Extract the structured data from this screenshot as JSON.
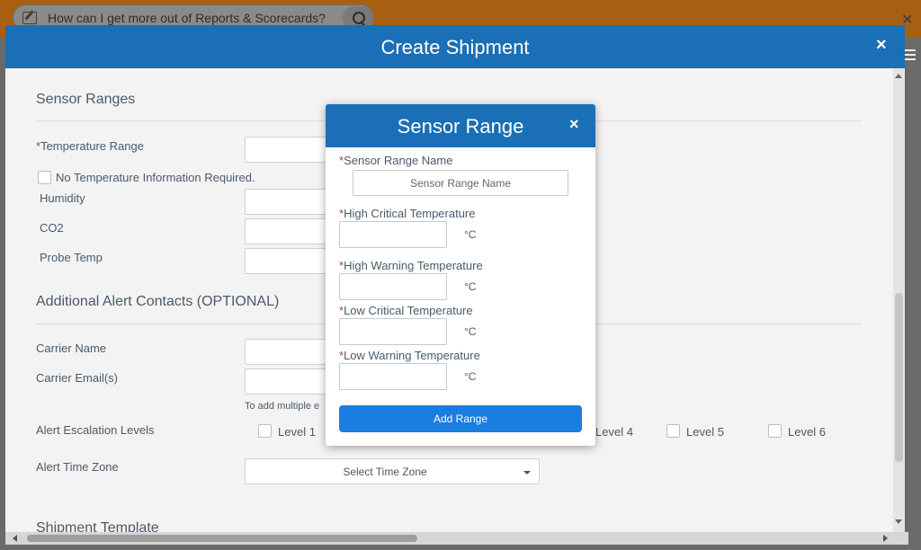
{
  "helpbar": {
    "question": "How can I get more out of Reports & Scorecards?"
  },
  "modal": {
    "title": "Create Shipment",
    "close": "×",
    "sensor_section": {
      "title": "Sensor Ranges",
      "temperature_label": "Temperature Range",
      "no_temp_label": "No Temperature Information Required.",
      "humidity_label": "Humidity",
      "co2_label": "CO2",
      "probe_label": "Probe Temp"
    },
    "alert_section": {
      "title": "Additional Alert Contacts (OPTIONAL)",
      "carrier_name_label": "Carrier Name",
      "carrier_email_label": "Carrier Email(s)",
      "email_hint": "To add multiple e",
      "escalation_label": "Alert Escalation Levels",
      "levels": [
        "Level 1",
        "Level 4",
        "Level 5",
        "Level 6"
      ],
      "timezone_label": "Alert Time Zone",
      "timezone_value": "Select Time Zone"
    },
    "template_section": {
      "title": "Shipment Template"
    }
  },
  "popup": {
    "title": "Sensor Range",
    "close": "×",
    "name_label": "Sensor Range Name",
    "name_placeholder": "Sensor Range Name",
    "fields": [
      {
        "label": "High Critical Temperature",
        "unit": "°C"
      },
      {
        "label": "High Warning Temperature",
        "unit": "°C"
      },
      {
        "label": "Low Critical Temperature",
        "unit": "°C"
      },
      {
        "label": "Low Warning Temperature",
        "unit": "°C"
      }
    ],
    "add_button": "Add Range"
  },
  "colors": {
    "header_blue": "#1a6fb7",
    "button_blue": "#1a7de0",
    "required_red": "#c0392b"
  },
  "icons": [
    "edit-icon",
    "search-icon",
    "close-icon",
    "menu-icon",
    "caret-down-icon"
  ]
}
